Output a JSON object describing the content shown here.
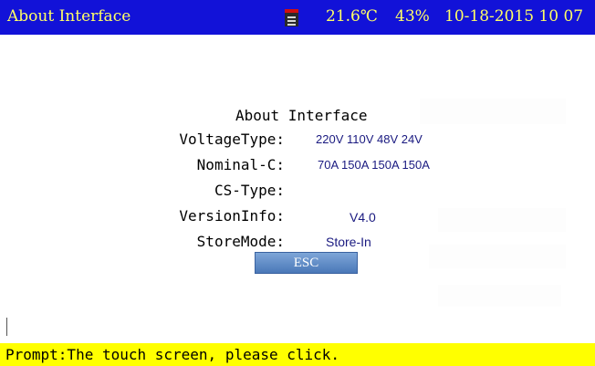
{
  "header": {
    "title": "About Interface",
    "storage_icon": "sd-card-icon",
    "temperature": "21.6℃",
    "humidity": "43%",
    "datetime": "10-18-2015 10 07"
  },
  "about": {
    "heading": "About Interface",
    "rows": [
      {
        "label": "VoltageType:",
        "value": "220V 110V 48V 24V"
      },
      {
        "label": "Nominal-C:",
        "value": "70A 150A 150A 150A"
      },
      {
        "label": "CS-Type:",
        "value": ""
      },
      {
        "label": "VersionInfo:",
        "value": "V4.0"
      },
      {
        "label": "StoreMode:",
        "value": "Store-In"
      }
    ],
    "esc_label": "ESC"
  },
  "prompt": {
    "text": "Prompt:The touch screen, please click."
  },
  "colors": {
    "titlebar_bg": "#1212d8",
    "titlebar_text": "#ffff66",
    "prompt_bg": "#ffff00",
    "button_bg": "#5f8cc8"
  }
}
